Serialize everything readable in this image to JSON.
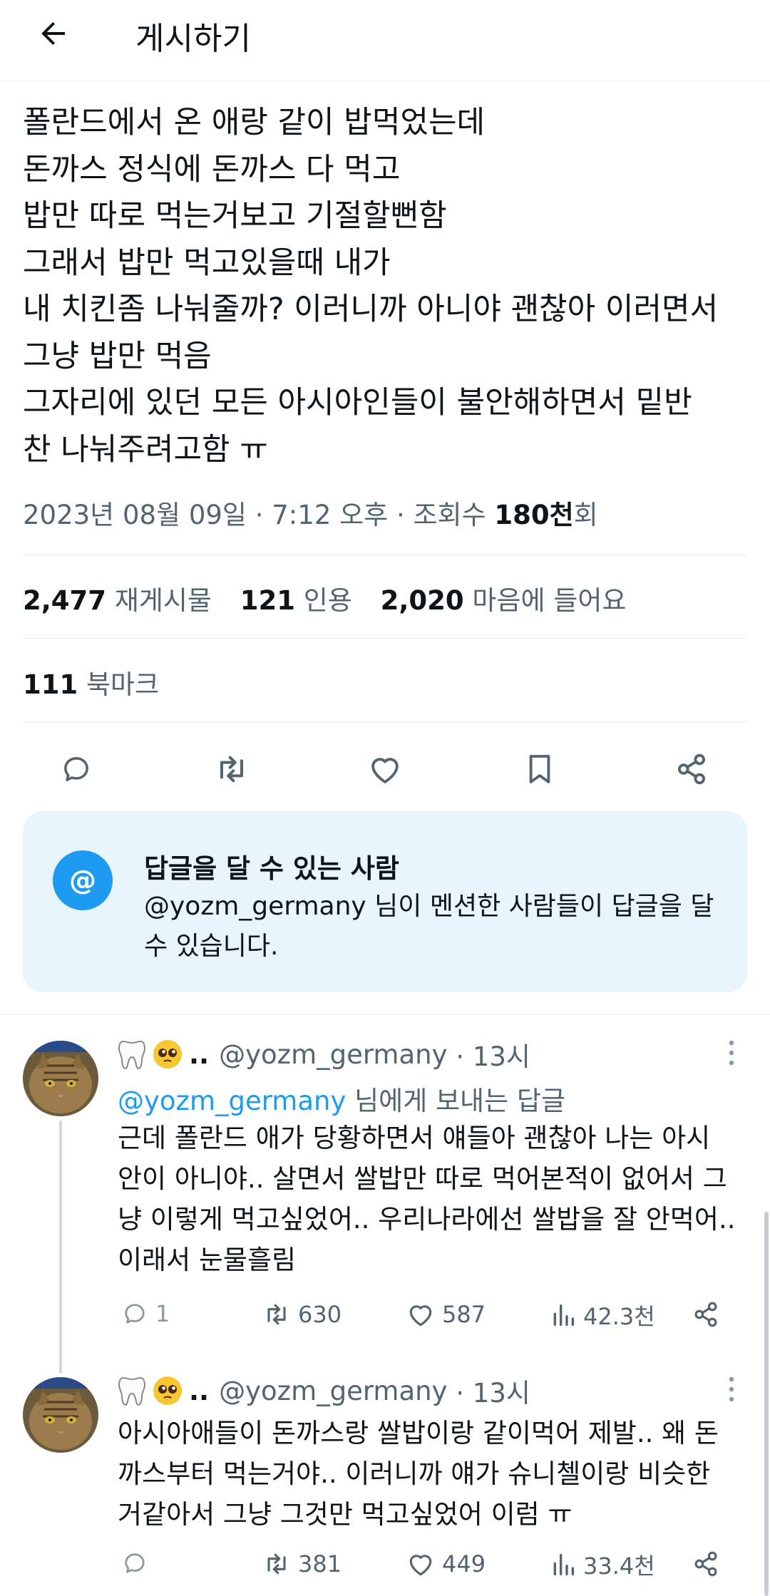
{
  "header": {
    "title": "게시하기"
  },
  "tweet": {
    "lines": [
      "폴란드에서 온 애랑 같이 밥먹었는데",
      "돈까스 정식에 돈까스 다 먹고",
      "밥만 따로 먹는거보고 기절할뻔함",
      "그래서 밥만 먹고있을때 내가",
      "내 치킨좀 나눠줄까? 이러니까 아니야 괜찮아 이러면서",
      "그냥 밥만 먹음",
      "그자리에 있던 모든 아시아인들이 불안해하면서 밑반",
      "찬 나눠주려고함 ㅠ"
    ],
    "date": "2023년 08월 09일",
    "time": "7:12 오후",
    "views_label": "조회수",
    "views_value": "180천",
    "views_suffix": "회"
  },
  "stats": {
    "retweets_num": "2,477",
    "retweets_label": "재게시물",
    "quotes_num": "121",
    "quotes_label": "인용",
    "likes_num": "2,020",
    "likes_label": "마음에 들어요",
    "bookmarks_num": "111",
    "bookmarks_label": "북마크"
  },
  "actions": {
    "icons": [
      "reply-icon",
      "retweet-icon",
      "like-icon",
      "bookmark-icon",
      "share-icon"
    ]
  },
  "reply_restriction": {
    "icon_char": "@",
    "title": "답글을 달 수 있는 사람",
    "desc": "@yozm_germany 님이 멘션한 사람들이 답글을 달 수 있습니다."
  },
  "replies": [
    {
      "name_suffix": "..",
      "handle": "@yozm_germany",
      "time": "· 13시",
      "reply_to_mention": "@yozm_germany",
      "reply_to_suffix": " 님에게 보내는 답글",
      "lines": [
        "근데 폴란드 애가 당황하면서 얘들아 괜찮아 나는 아시",
        "안이 아니야.. 살면서 쌀밥만 따로 먹어본적이 없어서 그",
        "냥 이렇게 먹고싶었어.. 우리나라에선 쌀밥을 잘 안먹어..",
        "이래서 눈물흘림"
      ],
      "reply_count": "1",
      "retweet_count": "630",
      "like_count": "587",
      "view_count": "42.3천"
    },
    {
      "name_suffix": "..",
      "handle": "@yozm_germany",
      "time": "· 13시",
      "lines": [
        "아시아애들이 돈까스랑 쌀밥이랑 같이먹어 제발.. 왜 돈",
        "까스부터 먹는거야.. 이러니까 얘가 슈니첼이랑 비슷한",
        "거같아서 그냥 그것만 먹고싶었어 이럼 ㅠ"
      ],
      "reply_count": "",
      "retweet_count": "381",
      "like_count": "449",
      "view_count": "33.4천"
    }
  ],
  "colors": {
    "accent": "#1d9bf0",
    "text": "#0f1419",
    "muted": "#536471",
    "reply_box_bg": "#e8f5fd"
  }
}
